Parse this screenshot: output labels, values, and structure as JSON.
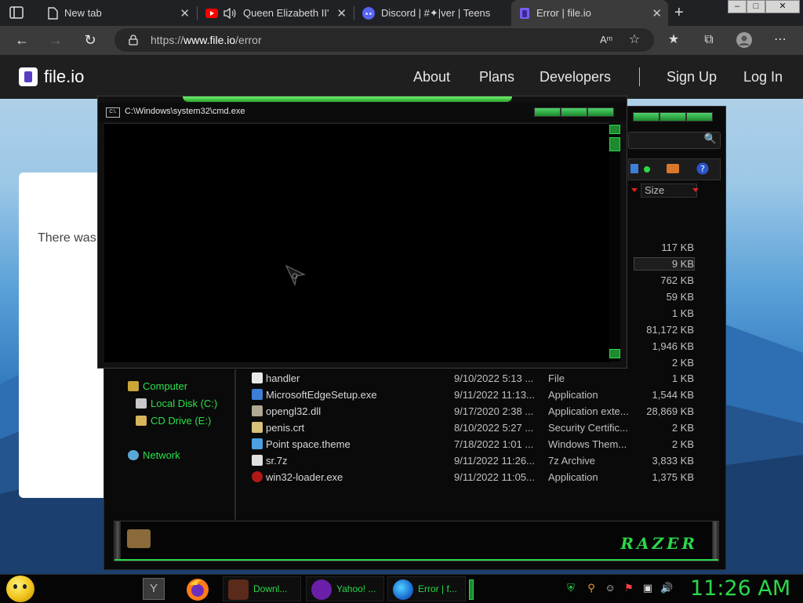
{
  "browser": {
    "tabs": [
      {
        "title": "New tab"
      },
      {
        "title": "Queen Elizabeth II's"
      },
      {
        "title": "Discord | #✦|ver | Teens"
      },
      {
        "title": "Error | file.io"
      }
    ],
    "close_glyph": "✕",
    "new_tab_glyph": "+",
    "window_controls": [
      "–",
      "□",
      "✕"
    ],
    "url_prefix": "https://",
    "url_host": "www.file.io",
    "url_path": "/error"
  },
  "site": {
    "logo_text": "file.io",
    "nav": [
      "About",
      "Plans",
      "Developers",
      "Sign Up",
      "Log In"
    ],
    "message": "There was a problem with your file."
  },
  "cmd": {
    "title": "C:\\Windows\\system32\\cmd.exe",
    "icon_text": "C:\\."
  },
  "explorer": {
    "size_header": "Size",
    "sizes_above": [
      "117 KB",
      "9 KB",
      "762 KB",
      "59 KB",
      "1 KB",
      "81,172 KB",
      "1,946 KB",
      "2 KB"
    ],
    "selected_size_index": 1,
    "tree": [
      {
        "label": "Computer",
        "icon": "computer-icon"
      },
      {
        "label": "Local Disk (C:)",
        "icon": "drive-icon"
      },
      {
        "label": "CD Drive (E:)",
        "icon": "cd-drive-icon"
      },
      {
        "label": "Network",
        "icon": "network-icon"
      }
    ],
    "files": [
      {
        "name": "handler",
        "date": "9/10/2022 5:13 ...",
        "type": "File",
        "size": "1 KB",
        "color": "#e8e8e8"
      },
      {
        "name": "MicrosoftEdgeSetup.exe",
        "date": "9/11/2022 11:13...",
        "type": "Application",
        "size": "1,544 KB",
        "color": "#3d7fd6"
      },
      {
        "name": "opengl32.dll",
        "date": "9/17/2020 2:38 ...",
        "type": "Application exte...",
        "size": "28,869 KB",
        "color": "#b0a890"
      },
      {
        "name": "penis.crt",
        "date": "8/10/2022 5:27 ...",
        "type": "Security Certific...",
        "size": "2 KB",
        "color": "#d9c27a"
      },
      {
        "name": "Point space.theme",
        "date": "7/18/2022 1:01 ...",
        "type": "Windows Them...",
        "size": "2 KB",
        "color": "#4aa0e0"
      },
      {
        "name": "sr.7z",
        "date": "9/11/2022 11:26...",
        "type": "7z Archive",
        "size": "3,833 KB",
        "color": "#e0e0e0"
      },
      {
        "name": "win32-loader.exe",
        "date": "9/11/2022 11:05...",
        "type": "Application",
        "size": "1,375 KB",
        "color": "#b01818"
      }
    ],
    "brand": "RAZER"
  },
  "taskbar": {
    "pinned_letter": "Y",
    "buttons": [
      {
        "label": "Downl...",
        "icon": "download-app-icon"
      },
      {
        "label": "Yahoo! ...",
        "icon": "yahoo-icon"
      },
      {
        "label": "Error | f...",
        "icon": "edge-icon"
      }
    ],
    "clock": "11:26 AM"
  },
  "colors": {
    "accent_green": "#2bd84a",
    "page_header": "#1f1f1f",
    "browser_bg": "#202124"
  }
}
